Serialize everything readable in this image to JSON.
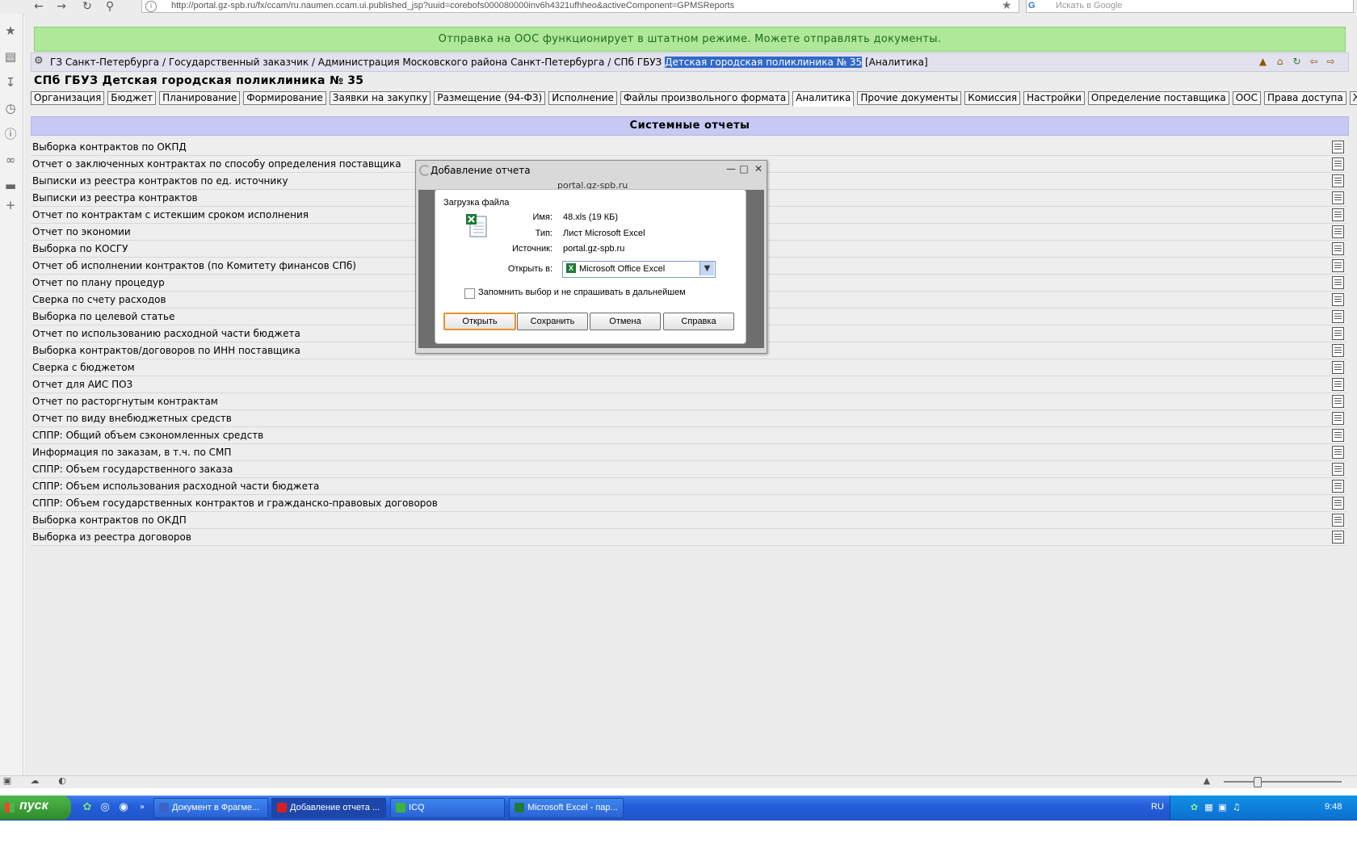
{
  "browser": {
    "url": "http://portal.gz-spb.ru/fx/ccam/ru.naumen.ccam.ui.published_jsp?uuid=corebofs000080000inv6h4321ufhheo&activeComponent=GPMSReports",
    "search_placeholder": "Искать в Google"
  },
  "notice": "Отправка на ООС функционирует в штатном режиме. Можете отправлять документы.",
  "breadcrumb": {
    "path": "ГЗ Санкт-Петербурга / Государственный заказчик / Администрация Московского района Санкт-Петербурга / СПб ГБУЗ ",
    "selected": "Детская городская поликлиника № 35",
    "suffix": " [Аналитика]"
  },
  "org_title": "СПб ГБУЗ Детская городская поликлиника № 35",
  "tabs": [
    {
      "label": "Организация"
    },
    {
      "label": "Бюджет"
    },
    {
      "label": "Планирование"
    },
    {
      "label": "Формирование"
    },
    {
      "label": "Заявки на закупку"
    },
    {
      "label": "Размещение (94-ФЗ)"
    },
    {
      "label": "Исполнение"
    },
    {
      "label": "Файлы произвольного формата"
    },
    {
      "label": "Аналитика"
    },
    {
      "label": "Прочие документы"
    },
    {
      "label": "Комиссия"
    },
    {
      "label": "Настройки"
    },
    {
      "label": "Определение поставщика"
    },
    {
      "label": "ООС"
    },
    {
      "label": "Права доступа"
    },
    {
      "label": "Журнал"
    }
  ],
  "active_tab": "Аналитика",
  "section_title": "Системные отчеты",
  "reports": [
    "Выборка контрактов по ОКПД",
    "Отчет о заключенных контрактах по способу определения поставщика",
    "Выписки из реестра контрактов по ед. источнику",
    "Выписки из реестра контрактов",
    "Отчет по контрактам с истекшим сроком исполнения",
    "Отчет по экономии",
    "Выборка по КОСГУ",
    "Отчет об исполнении контрактов (по Комитету финансов СПб)",
    "Отчет по плану процедур",
    "Сверка по счету расходов",
    "Выборка по целевой статье",
    "Отчет по использованию расходной части бюджета",
    "Выборка контрактов/договоров по ИНН поставщика",
    "Сверка с бюджетом",
    "Отчет для АИС ПОЗ",
    "Отчет по расторгнутым контрактам",
    "Отчет по виду внебюджетных средств",
    "СППР: Общий объем сэкономленных средств",
    "Информация по заказам, в т.ч. по СМП",
    "СППР: Объем государственного заказа",
    "СППР: Объем использования расходной части бюджета",
    "СППР: Объем государственных контрактов и гражданско-правовых договоров",
    "Выборка контрактов по ОКДП",
    "Выборка из реестра договоров"
  ],
  "dialog": {
    "title": "Добавление отчета",
    "host": "portal.gz-spb.ru",
    "download": {
      "heading": "Загрузка файла",
      "name_label": "Имя:",
      "name_value": "48.xls (19 КБ)",
      "type_label": "Тип:",
      "type_value": "Лист Microsoft Excel",
      "source_label": "Источник:",
      "source_value": "portal.gz-spb.ru",
      "open_with_label": "Открыть в:",
      "open_with_value": "Microsoft Office Excel",
      "remember_label": "Запомнить выбор и не спрашивать в дальнейшем",
      "buttons": {
        "open": "Открыть",
        "save": "Сохранить",
        "cancel": "Отмена",
        "help": "Справка"
      }
    }
  },
  "taskbar": {
    "start_label": "пуск",
    "tasks": [
      {
        "label": "Документ в Фрагме...",
        "icon_color": "#3a63c4"
      },
      {
        "label": "Добавление отчета ...",
        "icon_color": "#d62020"
      },
      {
        "label": "ICQ",
        "icon_color": "#3cb43c"
      },
      {
        "label": "Microsoft Excel - пар...",
        "icon_color": "#1e7a36"
      }
    ],
    "lang": "RU",
    "clock": "9:48"
  },
  "colors": {
    "notice_bg": "#b0e89a",
    "section_bg": "#c8c8f4",
    "selection": "#3169c6",
    "taskbar": "#245edb",
    "start": "#3c9c36"
  }
}
